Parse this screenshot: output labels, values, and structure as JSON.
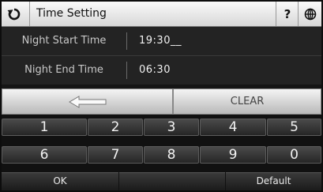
{
  "header": {
    "title": "Time Setting",
    "help_label": "?"
  },
  "fields": [
    {
      "label": "Night Start Time",
      "value": "19:30__"
    },
    {
      "label": "Night End Time",
      "value": "06:30"
    }
  ],
  "controls": {
    "backspace_icon": "left-arrow-icon",
    "clear_label": "CLEAR"
  },
  "keypad": {
    "row1": [
      "1",
      "2",
      "3",
      "4",
      "5"
    ],
    "row2": [
      "6",
      "7",
      "8",
      "9",
      "0"
    ]
  },
  "footer": {
    "ok_label": "OK",
    "default_label": "Default"
  }
}
